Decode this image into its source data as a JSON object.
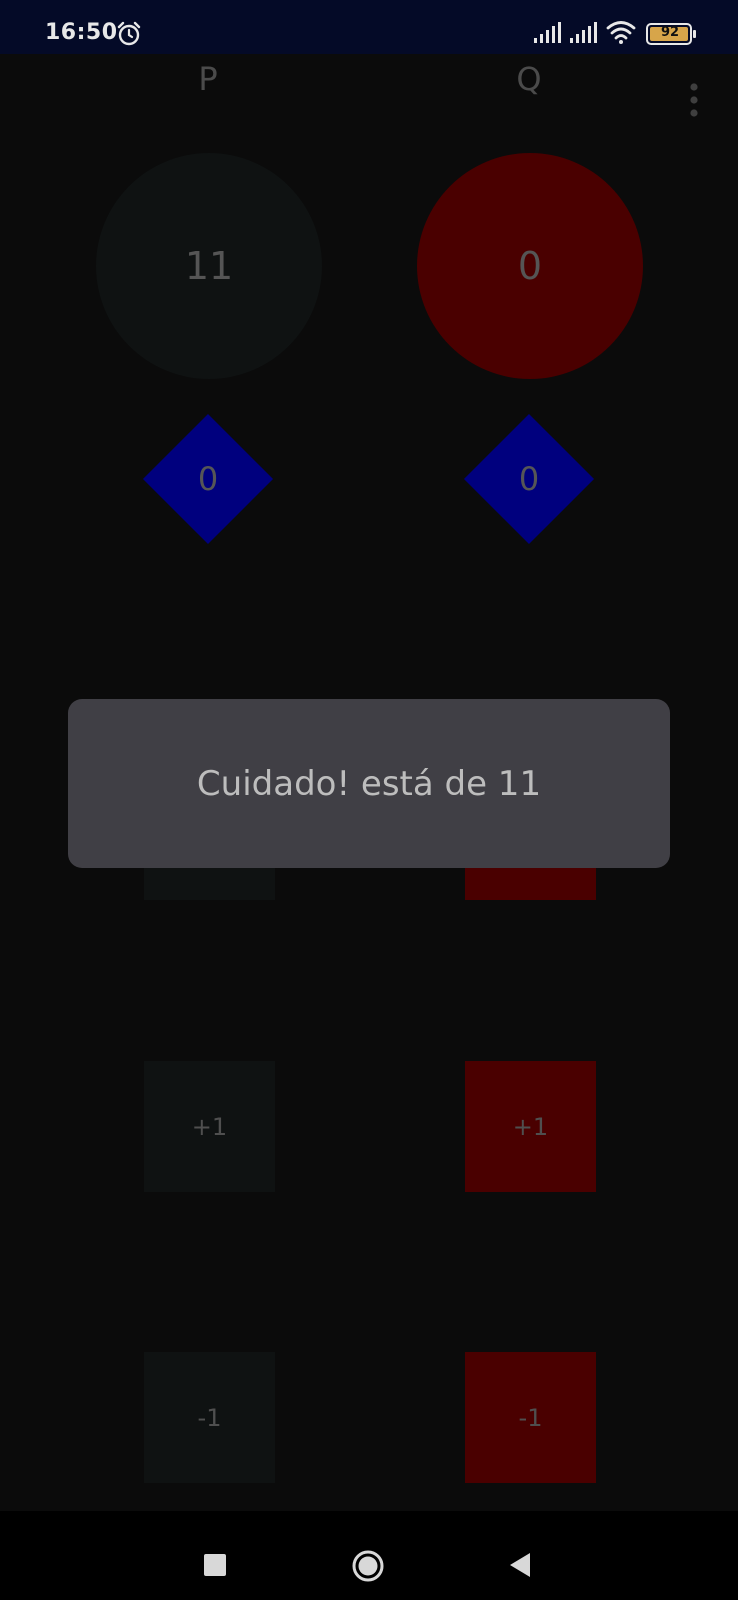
{
  "status_bar": {
    "time": "16:50",
    "battery": "92",
    "icons": [
      "alarm-icon",
      "signal-icon",
      "signal-icon",
      "wifi-icon",
      "battery-icon"
    ]
  },
  "players": {
    "p": {
      "label": "P",
      "score": "11",
      "sets": "0",
      "plus_label": "+1",
      "minus_label": "-1",
      "color": "#0f1212"
    },
    "q": {
      "label": "Q",
      "score": "0",
      "sets": "0",
      "plus_label": "+1",
      "minus_label": "-1",
      "color": "#4a0000"
    }
  },
  "sets_color": "#00007e",
  "toast": {
    "message": "Cuidado! está de 11"
  },
  "menu": {
    "icon": "more-vert-icon"
  },
  "nav_bar": {
    "icons": [
      "recents-icon",
      "home-icon",
      "back-icon"
    ]
  }
}
